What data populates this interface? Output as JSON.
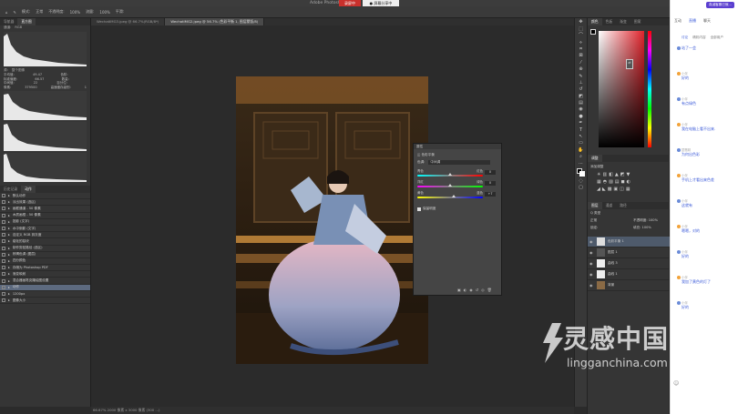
{
  "window": {
    "title": "Adobe Photoshop",
    "record_label": "录屏中",
    "share_label": "● 屏幕分享中"
  },
  "optbar": {
    "items": [
      "模式:",
      "正常",
      "不透明度:",
      "100%",
      "流量:",
      "100%",
      "平滑:"
    ]
  },
  "tabs": [
    {
      "label": "WechatIMG3.jpeg @ 66.7%(RGB/8*)",
      "active": false
    },
    {
      "label": "WechatIMG2.jpeg @ 56.7% (色彩平衡 1, 图层蒙版/8)",
      "active": true
    }
  ],
  "left": {
    "tabs": [
      {
        "label": "导航器",
        "on": false
      },
      {
        "label": "直方图",
        "on": true
      }
    ],
    "channel_label": "通道:",
    "channel_value": "RGB",
    "source_label": "源:",
    "source_value": "整个图像",
    "stats": [
      {
        "k": "平均值:",
        "v": "49.47",
        "k2": "色阶:",
        "v2": ""
      },
      {
        "k": "标准偏差:",
        "v": "66.57",
        "k2": "数量:",
        "v2": ""
      },
      {
        "k": "中间值:",
        "v": "22",
        "k2": "百分位:",
        "v2": ""
      },
      {
        "k": "像素:",
        "v": "379500",
        "k2": "高速缓存级别:",
        "v2": "1"
      }
    ],
    "history_tabs": [
      {
        "label": "历史记录",
        "on": false
      },
      {
        "label": "动作",
        "on": true
      }
    ],
    "history_items": [
      {
        "label": "默认动作",
        "sel": false
      },
      {
        "label": "淡出效果 (选区)",
        "sel": false
      },
      {
        "label": "画框通道 - 50 像素",
        "sel": false
      },
      {
        "label": "木质画框 - 50 像素",
        "sel": false
      },
      {
        "label": "投影 (文字)",
        "sel": false
      },
      {
        "label": "水中倒影 (文字)",
        "sel": false
      },
      {
        "label": "自定义 RGB 到灰度",
        "sel": false
      },
      {
        "label": "熔化的铅块",
        "sel": false
      },
      {
        "label": "制作剪贴路径 (选区)",
        "sel": false
      },
      {
        "label": "棕褐色调 (图层)",
        "sel": false
      },
      {
        "label": "四分颜色",
        "sel": false
      },
      {
        "label": "存储为 Photoshop PDF",
        "sel": false
      },
      {
        "label": "渐变映射",
        "sel": false
      },
      {
        "label": "混合器画笔克隆绘图设置",
        "sel": false
      },
      {
        "label": "动作",
        "sel": true
      },
      {
        "label": "1200px",
        "sel": false
      },
      {
        "label": "图像大小",
        "sel": false
      }
    ]
  },
  "status": {
    "text": "66.67%   2000 像素 x 3000 像素 (300 ...)"
  },
  "dialog": {
    "title": "属性",
    "subtitle": "色彩平衡",
    "tone_label": "色调:",
    "tone_value": "中间调",
    "sliders": [
      {
        "left": "青色",
        "right": "红色",
        "value": "0",
        "pos": 0.5
      },
      {
        "left": "洋红",
        "right": "绿色",
        "value": "0",
        "pos": 0.5
      },
      {
        "left": "黄色",
        "right": "蓝色",
        "value": "+7",
        "pos": 0.55
      }
    ],
    "preserve_label": "保留明度"
  },
  "right": {
    "color_tabs": [
      "颜色",
      "色板",
      "渐变",
      "图案"
    ],
    "adjust_tabs": [
      "调整"
    ],
    "adjust_label": "添加调整",
    "layer_tabs": [
      "图层",
      "通道",
      "路径"
    ],
    "kind_label": "Q 类型",
    "blend_label": "正常",
    "opacity_label": "不透明度: 100%",
    "lock_label": "锁定:",
    "fill_label": "填充: 100%",
    "layers": [
      {
        "name": "色彩平衡 1",
        "sel": true,
        "tone": "#ddd"
      },
      {
        "name": "图层 1",
        "sel": false,
        "tone": "#555"
      },
      {
        "name": "曲线 3",
        "sel": false,
        "tone": "#eee"
      },
      {
        "name": "曲线 1",
        "sel": false,
        "tone": "#eee"
      },
      {
        "name": "背景",
        "sel": false,
        "tone": "#8a6a45"
      }
    ]
  },
  "chat": {
    "top_badge": "真诚客服已就...",
    "tabs": [
      "互动",
      "直播",
      "聊天"
    ],
    "sub_tabs": [
      "讨论",
      "精彩内容",
      "全部用户"
    ],
    "messages": [
      {
        "user": "",
        "text": "站了一会"
      },
      {
        "user": "小伴",
        "text": "好的"
      },
      {
        "user": "小伴",
        "text": "有点绿色"
      },
      {
        "user": "小伴",
        "text": "我在电脑上看不出来."
      },
      {
        "user": "琵琶精",
        "text": "为何出色彩"
      },
      {
        "user": "小伴",
        "text": "手机上才看出来色差"
      },
      {
        "user": "小伴",
        "text": "这就有"
      },
      {
        "user": "小伴",
        "text": "嗯嗯，对的"
      },
      {
        "user": "小伴",
        "text": "好的"
      },
      {
        "user": "小伴",
        "text": "我加了黄色的灯了"
      },
      {
        "user": "小伴",
        "text": "好的"
      }
    ],
    "input_icon": "smile-icon"
  },
  "watermark": {
    "title": "灵感中国",
    "url": "lingganchina.com"
  }
}
